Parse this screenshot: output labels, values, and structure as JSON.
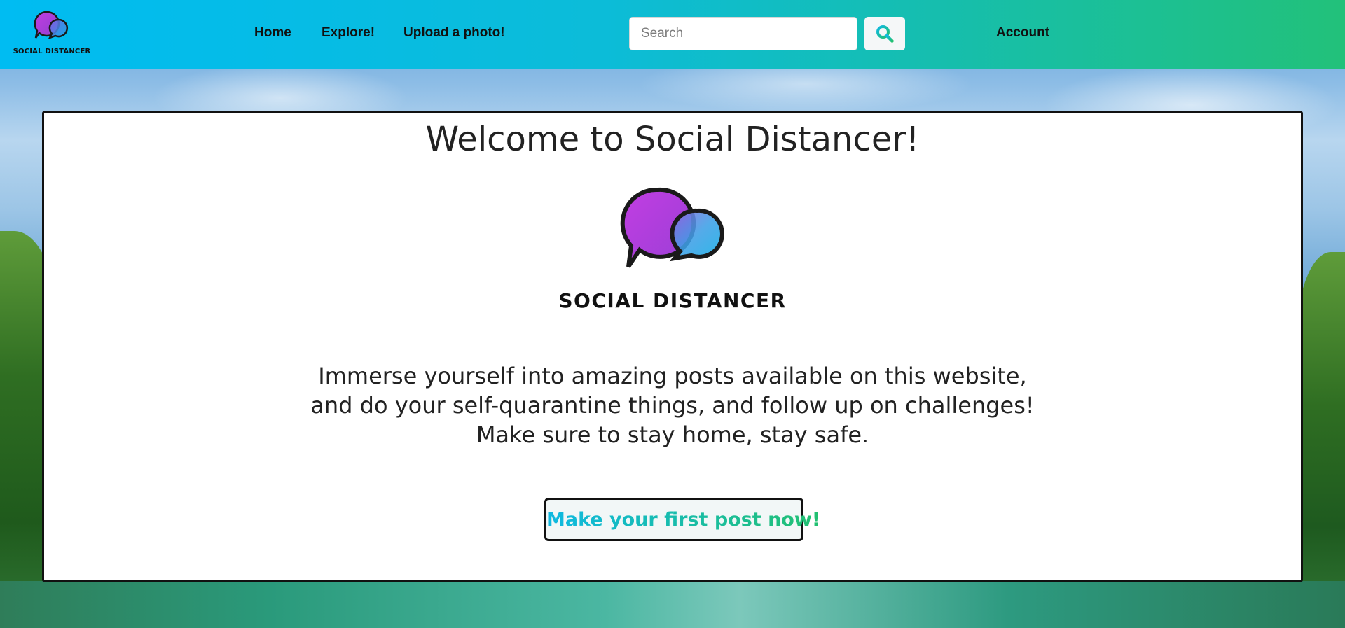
{
  "navbar": {
    "brand_text": "SOCIAL DISTANCER",
    "links": [
      {
        "label": "Home"
      },
      {
        "label": "Explore!"
      },
      {
        "label": "Upload a photo!"
      }
    ],
    "search": {
      "placeholder": "Search",
      "value": ""
    },
    "search_icon": "magnifier-icon",
    "account_label": "Account"
  },
  "main": {
    "title": "Welcome to Social Distancer!",
    "logo_text": "SOCIAL DISTANCER",
    "tagline": [
      "Immerse yourself into amazing posts available on this website,",
      "and do your self-quarantine things, and follow up on challenges!",
      "Make sure to stay home, stay safe."
    ],
    "cta_label": "Make your first post now!"
  },
  "colors": {
    "nav_gradient_start": "#00bcf2",
    "nav_gradient_end": "#22c17a",
    "bubble_purple": "#b23dd8",
    "bubble_blue": "#1aa8e8",
    "cta_gradient_start": "#0fb9e2",
    "cta_gradient_end": "#22c070"
  }
}
